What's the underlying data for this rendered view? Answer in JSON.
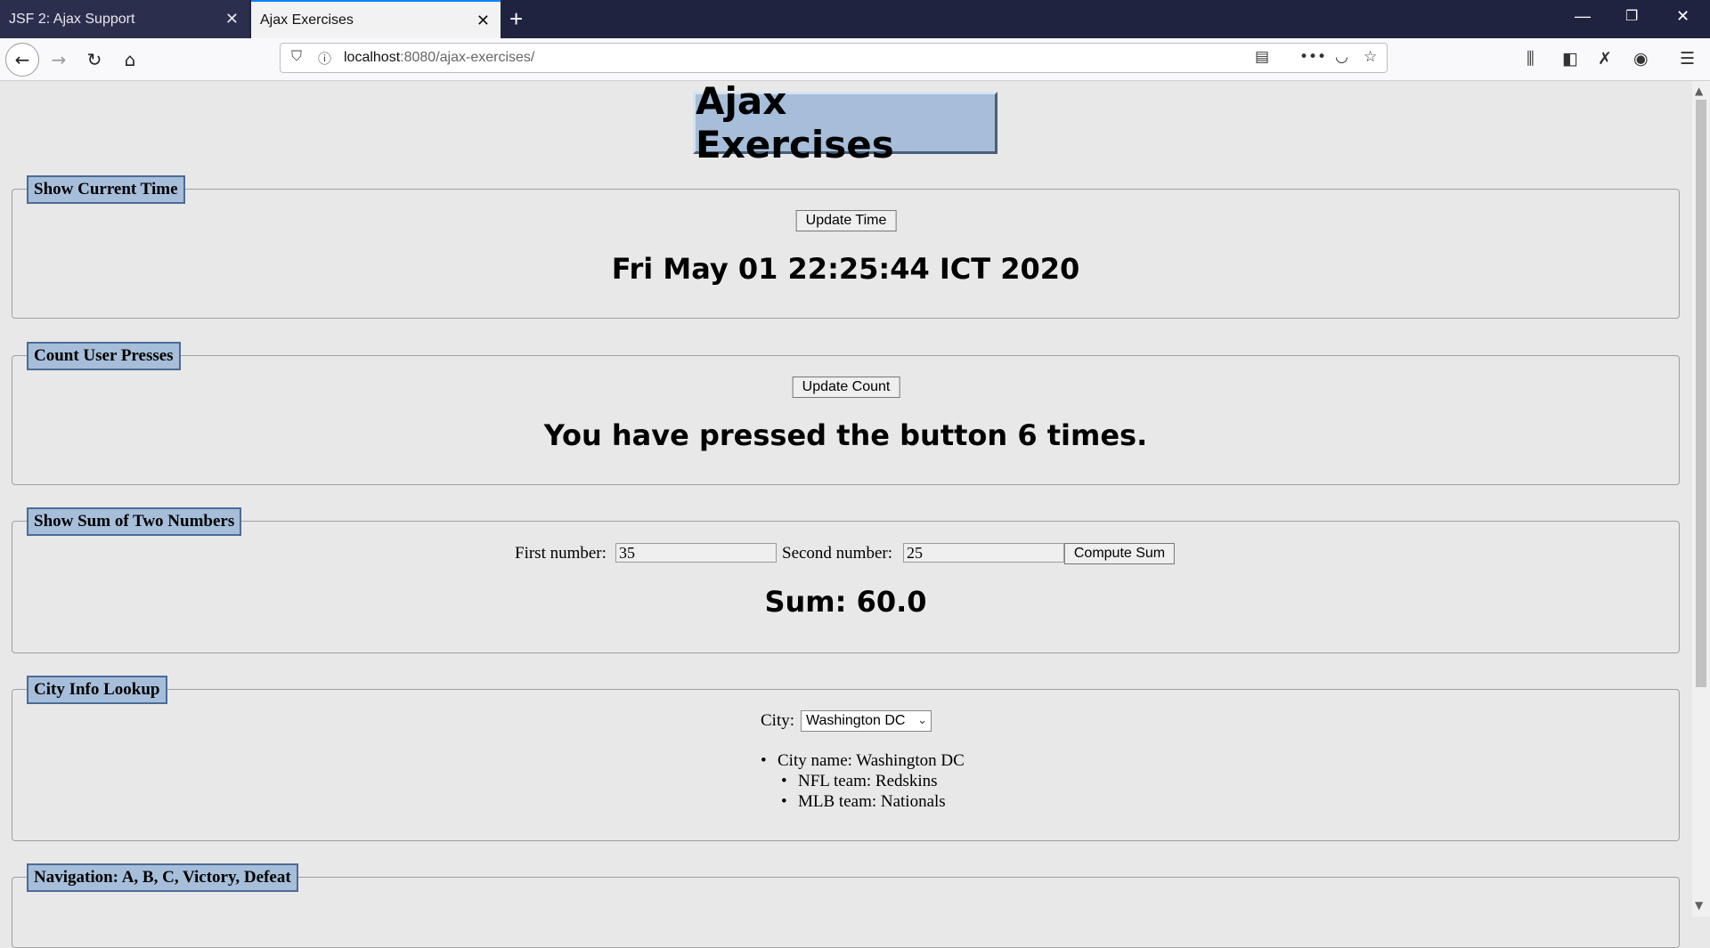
{
  "browser": {
    "tabs": [
      {
        "label": "JSF 2: Ajax Support",
        "active": false
      },
      {
        "label": "Ajax Exercises",
        "active": true
      }
    ],
    "url_host": "localhost",
    "url_rest": ":8080/ajax-exercises/"
  },
  "page": {
    "title": "Ajax Exercises",
    "time_section": {
      "legend": "Show Current Time",
      "button_label": "Update Time",
      "time_text": "Fri May 01 22:25:44 ICT 2020"
    },
    "count_section": {
      "legend": "Count User Presses",
      "button_label": "Update Count",
      "count_text": "You have pressed the button 6 times."
    },
    "sum_section": {
      "legend": "Show Sum of Two Numbers",
      "first_label": "First number:",
      "first_value": "35",
      "second_label": "Second number:",
      "second_value": "25",
      "button_label": "Compute Sum",
      "sum_text": "Sum: 60.0"
    },
    "city_section": {
      "legend": "City Info Lookup",
      "city_label": "City:",
      "city_selected": "Washington DC",
      "city_name": "City name: Washington DC",
      "nfl": "NFL team: Redskins",
      "mlb": "MLB team: Nationals"
    },
    "nav_section": {
      "legend": "Navigation: A, B, C, Victory, Defeat"
    }
  },
  "icons": [
    "back-icon",
    "forward-icon",
    "reload-icon",
    "home-icon",
    "shield-icon",
    "info-icon",
    "reader-icon",
    "more-icon",
    "pocket-icon",
    "bookmark-star-icon",
    "library-icon",
    "sidebar-icon",
    "extension-icon",
    "account-icon",
    "menu-icon"
  ]
}
